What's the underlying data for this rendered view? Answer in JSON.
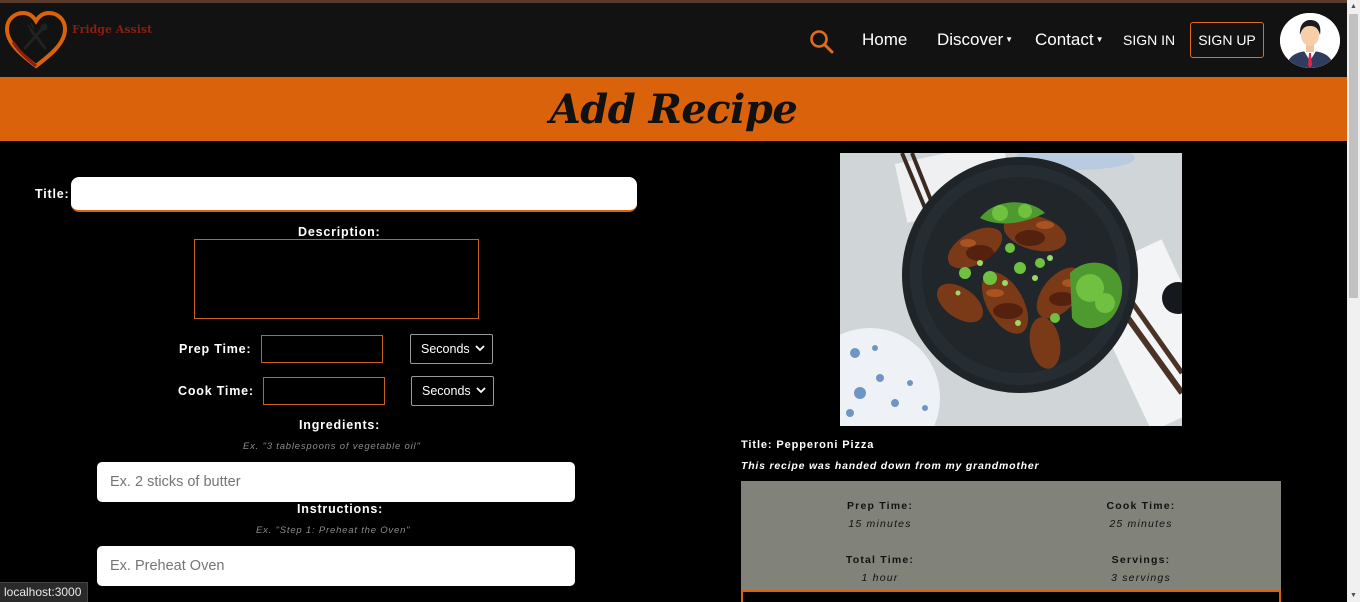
{
  "app": {
    "brand_name": "Fridge Assist"
  },
  "nav": {
    "home": "Home",
    "discover": "Discover",
    "contact": "Contact",
    "sign_in": "SIGN IN",
    "sign_up": "SIGN UP"
  },
  "banner": {
    "title": "Add Recipe"
  },
  "form": {
    "title_label": "Title:",
    "title_value": "",
    "description_label": "Description:",
    "description_value": "",
    "prep_time_label": "Prep Time:",
    "prep_time_value": "",
    "prep_time_unit": "Seconds",
    "cook_time_label": "Cook Time:",
    "cook_time_value": "",
    "cook_time_unit": "Seconds",
    "ingredients_label": "Ingredients:",
    "ingredients_hint": "Ex. \"3 tablespoons of vegetable oil\"",
    "ingredients_placeholder": "Ex. 2 sticks of butter",
    "instructions_label": "Instructions:",
    "instructions_hint": "Ex. \"Step 1: Preheat the Oven\"",
    "instructions_placeholder": "Ex. Preheat Oven"
  },
  "preview": {
    "title": "Title: Pepperoni Pizza",
    "description": "This recipe was handed down from my grandmother",
    "prep_time_label": "Prep Time:",
    "prep_time_value": "15 minutes",
    "cook_time_label": "Cook Time:",
    "cook_time_value": "25 minutes",
    "total_time_label": "Total Time:",
    "total_time_value": "1 hour",
    "servings_label": "Servings:",
    "servings_value": "3 servings"
  },
  "status_bar": {
    "url": "localhost:3000"
  },
  "colors": {
    "accent": "#d9620a",
    "navbar_bg": "#121212",
    "page_bg": "#000000",
    "stats_bg": "#818279"
  }
}
